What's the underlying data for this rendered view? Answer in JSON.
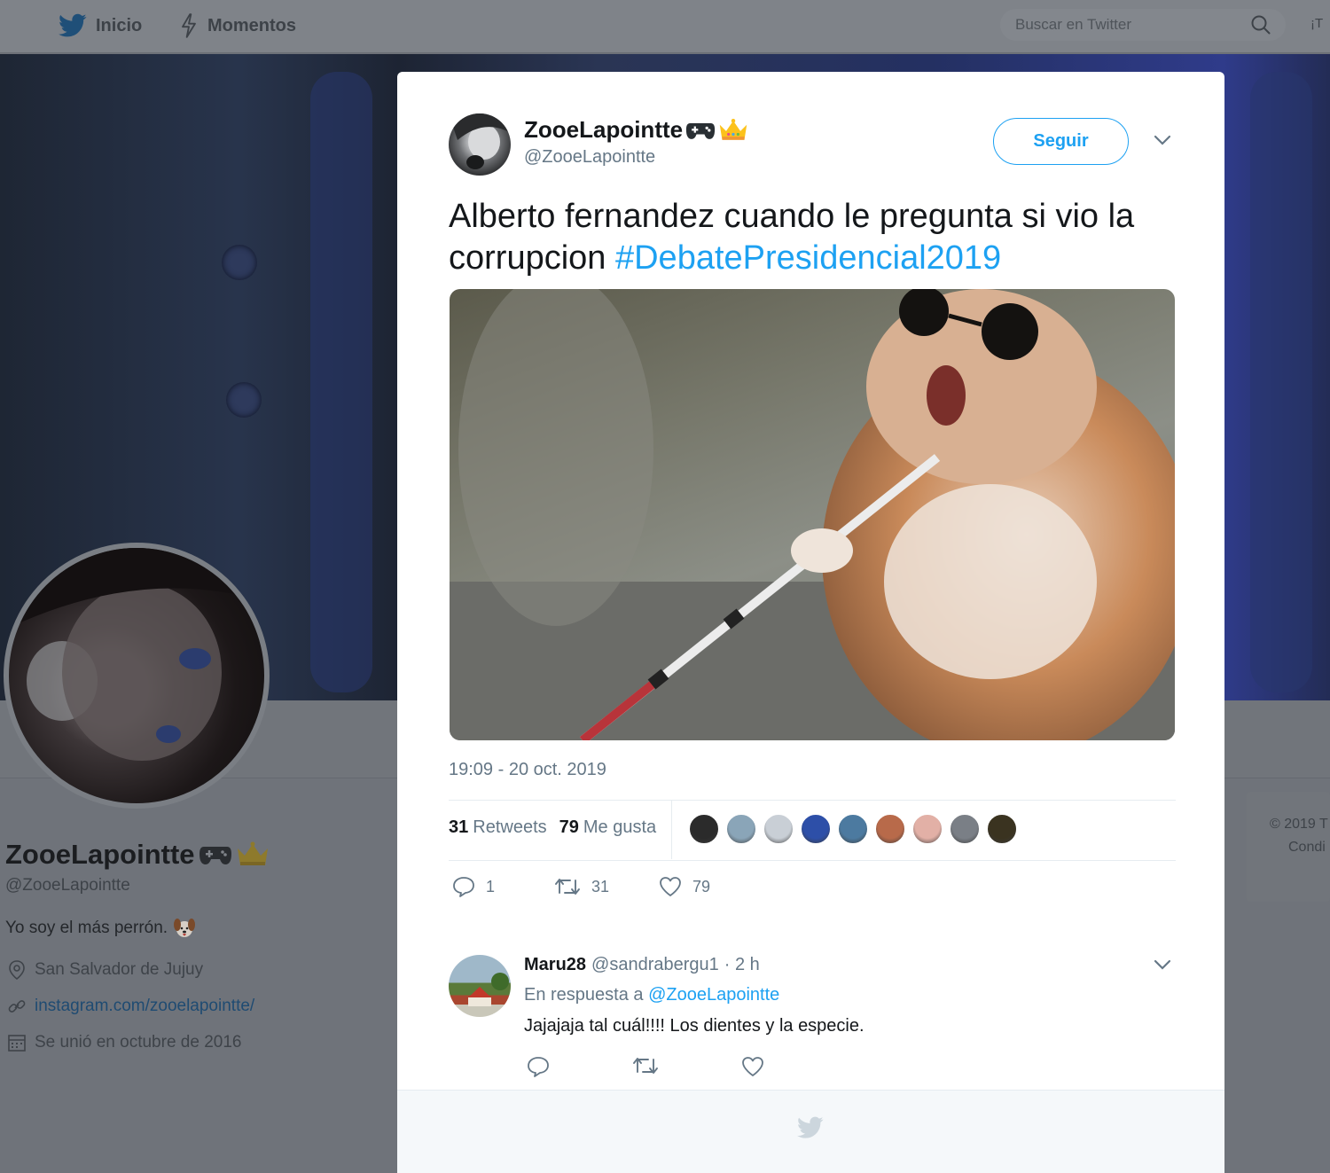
{
  "topnav": {
    "home_label": "Inicio",
    "moments_label": "Momentos",
    "search_placeholder": "Buscar en Twitter",
    "truncated_item": "¡T"
  },
  "profile": {
    "name": "ZooeLapointte",
    "handle": "@ZooeLapointte",
    "bio": "Yo soy el más perrón.",
    "location": "San Salvador de Jujuy",
    "website": "instagram.com/zooelapointte/",
    "joined": "Se unió en octubre de 2016",
    "footer_line1": "© 2019 T",
    "footer_line2": "Condi"
  },
  "tweet": {
    "author_name": "ZooeLapointte",
    "author_handle": "@ZooeLapointte",
    "follow_label": "Seguir",
    "text": "Alberto fernandez cuando le pregunta si vio la corrupcion ",
    "hashtag": "#DebatePresidencial2019",
    "timestamp": "19:09 - 20 oct. 2019",
    "retweets_count": "31",
    "retweets_label": "Retweets",
    "likes_count": "79",
    "likes_label": "Me gusta",
    "action_reply_count": "1",
    "action_retweet_count": "31",
    "action_like_count": "79"
  },
  "liker_colors": [
    "#2b2b2b",
    "#8aa5b8",
    "#c9cfd6",
    "#2d4fa8",
    "#4c7aa0",
    "#b86a4a",
    "#e2b0a6",
    "#7a7f86",
    "#3a3320"
  ],
  "reply": {
    "name": "Maru28",
    "handle": "@sandrabergu1",
    "time": "· 2 h",
    "in_reply_prefix": "En respuesta a",
    "in_reply_handle": "@ZooeLapointte",
    "text": "Jajajaja tal cuál!!!! Los dientes y la especie."
  },
  "colors": {
    "accent": "#1da1f2",
    "text_secondary": "#657786"
  }
}
